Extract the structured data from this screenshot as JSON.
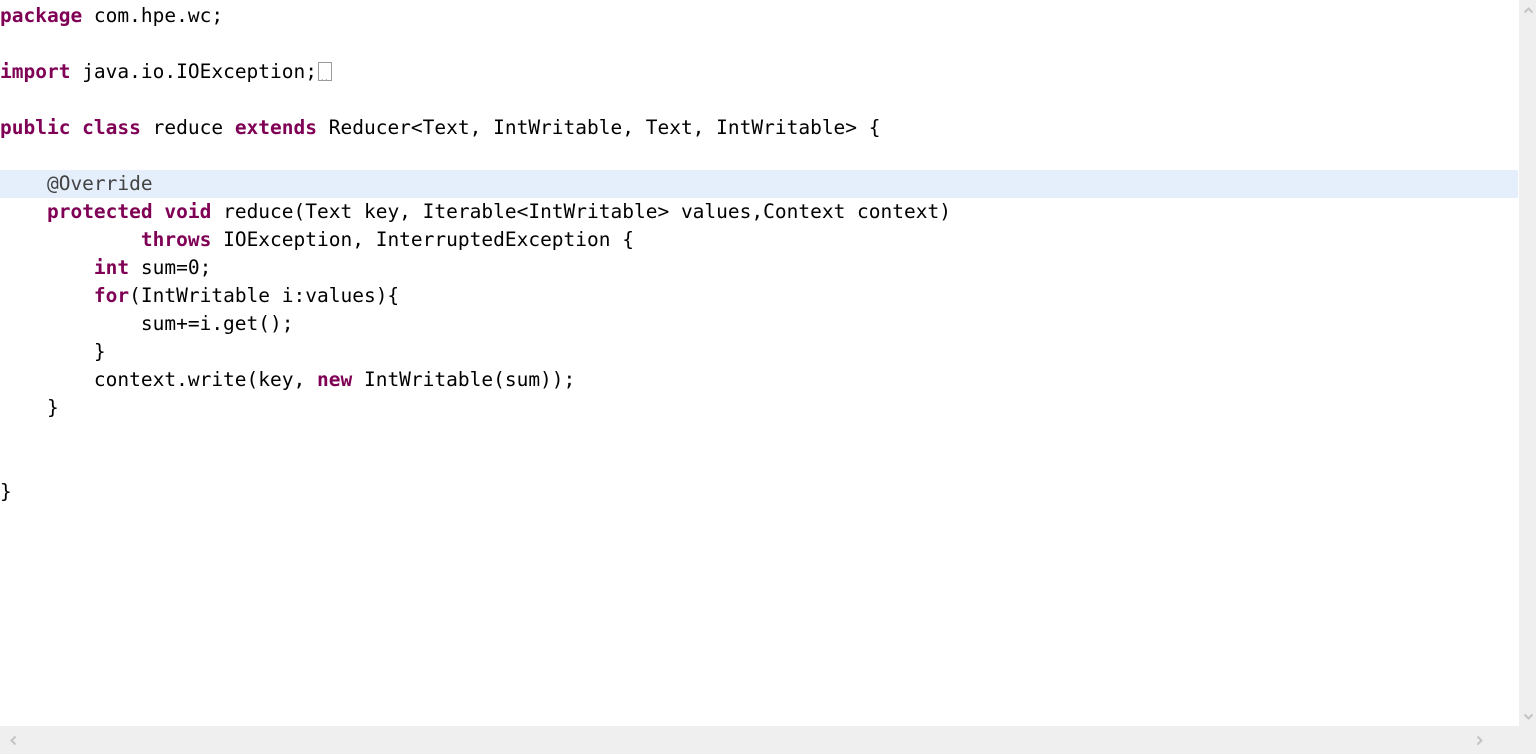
{
  "editor": {
    "language": "Java",
    "theme": {
      "background": "#ffffff",
      "foreground": "#000000",
      "keyword": "#7f0055",
      "annotation": "#434343",
      "current_line_highlight": "#e5eefb",
      "scrollbar_track": "#efefef",
      "scrollbar_arrow": "#c4c4c4"
    },
    "current_line_number": 7,
    "code_lines": [
      {
        "n": 1,
        "current": false,
        "tokens": [
          {
            "t": "kw",
            "s": "package"
          },
          {
            "t": "plain",
            "s": " com.hpe.wc;"
          }
        ]
      },
      {
        "n": 2,
        "current": false,
        "tokens": []
      },
      {
        "n": 3,
        "current": false,
        "tokens": [
          {
            "t": "kw",
            "s": "import"
          },
          {
            "t": "plain",
            "s": " java.io.IOException;"
          },
          {
            "t": "badglyph",
            "s": ""
          }
        ]
      },
      {
        "n": 4,
        "current": false,
        "tokens": []
      },
      {
        "n": 5,
        "current": false,
        "tokens": [
          {
            "t": "kw",
            "s": "public class"
          },
          {
            "t": "plain",
            "s": " reduce "
          },
          {
            "t": "kw",
            "s": "extends"
          },
          {
            "t": "plain",
            "s": " Reducer<Text, IntWritable, Text, IntWritable> {"
          }
        ]
      },
      {
        "n": 6,
        "current": false,
        "tokens": []
      },
      {
        "n": 7,
        "current": true,
        "tokens": [
          {
            "t": "annot",
            "s": "    @Override"
          }
        ]
      },
      {
        "n": 8,
        "current": false,
        "tokens": [
          {
            "t": "plain",
            "s": "    "
          },
          {
            "t": "kw",
            "s": "protected void"
          },
          {
            "t": "plain",
            "s": " reduce(Text key, Iterable<IntWritable> values,Context context)"
          }
        ]
      },
      {
        "n": 9,
        "current": false,
        "tokens": [
          {
            "t": "plain",
            "s": "            "
          },
          {
            "t": "kw",
            "s": "throws"
          },
          {
            "t": "plain",
            "s": " IOException, InterruptedException {"
          }
        ]
      },
      {
        "n": 10,
        "current": false,
        "tokens": [
          {
            "t": "plain",
            "s": "        "
          },
          {
            "t": "kw",
            "s": "int"
          },
          {
            "t": "plain",
            "s": " sum=0;"
          }
        ]
      },
      {
        "n": 11,
        "current": false,
        "tokens": [
          {
            "t": "plain",
            "s": "        "
          },
          {
            "t": "kw",
            "s": "for"
          },
          {
            "t": "plain",
            "s": "(IntWritable i:values){"
          }
        ]
      },
      {
        "n": 12,
        "current": false,
        "tokens": [
          {
            "t": "plain",
            "s": "            sum+=i.get();"
          }
        ]
      },
      {
        "n": 13,
        "current": false,
        "tokens": [
          {
            "t": "plain",
            "s": "        }"
          }
        ]
      },
      {
        "n": 14,
        "current": false,
        "tokens": [
          {
            "t": "plain",
            "s": "        context.write(key, "
          },
          {
            "t": "kw",
            "s": "new"
          },
          {
            "t": "plain",
            "s": " IntWritable(sum));"
          }
        ]
      },
      {
        "n": 15,
        "current": false,
        "tokens": [
          {
            "t": "plain",
            "s": "    }"
          }
        ]
      },
      {
        "n": 16,
        "current": false,
        "tokens": []
      },
      {
        "n": 17,
        "current": false,
        "tokens": []
      },
      {
        "n": 18,
        "current": false,
        "tokens": [
          {
            "t": "plain",
            "s": "}"
          }
        ]
      }
    ]
  },
  "scrollbars": {
    "vertical": {
      "up_arrow_icon": "chevron-up-icon",
      "down_arrow_icon": "chevron-down-icon"
    },
    "horizontal": {
      "left_arrow_icon": "chevron-left-icon",
      "right_arrow_icon": "chevron-right-icon"
    }
  }
}
